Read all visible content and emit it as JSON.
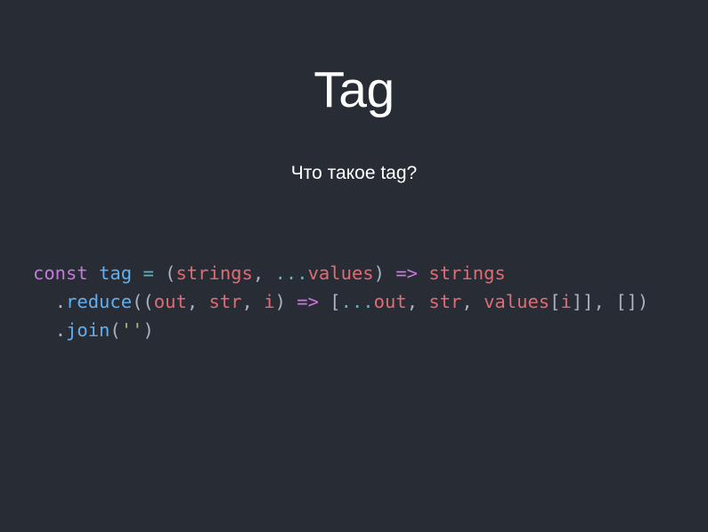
{
  "slide": {
    "title": "Tag",
    "subtitle": "Что такое tag?"
  },
  "code": {
    "lines": [
      [
        {
          "text": "const",
          "color": "#c678dd"
        },
        {
          "text": " ",
          "color": "#abb2bf"
        },
        {
          "text": "tag",
          "color": "#61afef"
        },
        {
          "text": " ",
          "color": "#abb2bf"
        },
        {
          "text": "=",
          "color": "#56b6c2"
        },
        {
          "text": " (",
          "color": "#abb2bf"
        },
        {
          "text": "strings",
          "color": "#e06c75"
        },
        {
          "text": ", ",
          "color": "#abb2bf"
        },
        {
          "text": "...",
          "color": "#56b6c2"
        },
        {
          "text": "values",
          "color": "#e06c75"
        },
        {
          "text": ") ",
          "color": "#abb2bf"
        },
        {
          "text": "=>",
          "color": "#c678dd"
        },
        {
          "text": " ",
          "color": "#abb2bf"
        },
        {
          "text": "strings",
          "color": "#e06c75"
        }
      ],
      [
        {
          "text": "  ",
          "color": "#abb2bf"
        },
        {
          "text": ".",
          "color": "#abb2bf"
        },
        {
          "text": "reduce",
          "color": "#61afef"
        },
        {
          "text": "((",
          "color": "#abb2bf"
        },
        {
          "text": "out",
          "color": "#e06c75"
        },
        {
          "text": ", ",
          "color": "#abb2bf"
        },
        {
          "text": "str",
          "color": "#e06c75"
        },
        {
          "text": ", ",
          "color": "#abb2bf"
        },
        {
          "text": "i",
          "color": "#e06c75"
        },
        {
          "text": ") ",
          "color": "#abb2bf"
        },
        {
          "text": "=>",
          "color": "#c678dd"
        },
        {
          "text": " [",
          "color": "#abb2bf"
        },
        {
          "text": "...",
          "color": "#56b6c2"
        },
        {
          "text": "out",
          "color": "#e06c75"
        },
        {
          "text": ", ",
          "color": "#abb2bf"
        },
        {
          "text": "str",
          "color": "#e06c75"
        },
        {
          "text": ", ",
          "color": "#abb2bf"
        },
        {
          "text": "values",
          "color": "#e06c75"
        },
        {
          "text": "[",
          "color": "#abb2bf"
        },
        {
          "text": "i",
          "color": "#e06c75"
        },
        {
          "text": "]], [])",
          "color": "#abb2bf"
        }
      ],
      [
        {
          "text": "  ",
          "color": "#abb2bf"
        },
        {
          "text": ".",
          "color": "#abb2bf"
        },
        {
          "text": "join",
          "color": "#61afef"
        },
        {
          "text": "(",
          "color": "#abb2bf"
        },
        {
          "text": "''",
          "color": "#98c379"
        },
        {
          "text": ")",
          "color": "#abb2bf"
        }
      ]
    ]
  }
}
